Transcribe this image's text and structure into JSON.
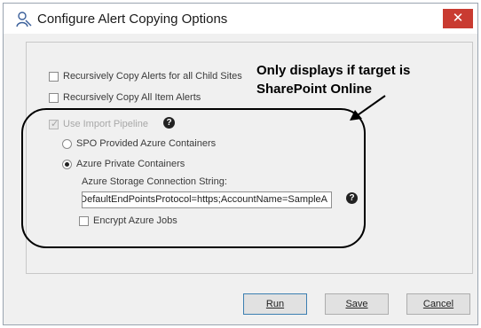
{
  "window": {
    "title": "Configure Alert Copying Options",
    "close_glyph": "✕",
    "app_icon": "sharegate-person-icon"
  },
  "options": {
    "copy_child_sites_label": "Recursively Copy Alerts for all Child Sites",
    "copy_item_alerts_label": "Recursively Copy All Item Alerts",
    "use_import_pipeline_label": "Use Import Pipeline",
    "spo_containers_label": "SPO Provided Azure Containers",
    "private_containers_label": "Azure Private Containers",
    "connection_string_label": "Azure Storage Connection String:",
    "connection_string_value": "DefaultEndPointsProtocol=https;AccountName=SampleA",
    "encrypt_jobs_label": "Encrypt Azure Jobs",
    "help_glyph": "?"
  },
  "callout": {
    "line1": "Only displays if target is",
    "line2": "SharePoint Online"
  },
  "buttons": {
    "run_label": "Run",
    "save_label": "Save",
    "cancel_label": "Cancel"
  },
  "colors": {
    "close_button": "#c93b31",
    "dialog_background": "#f0f0f0"
  }
}
